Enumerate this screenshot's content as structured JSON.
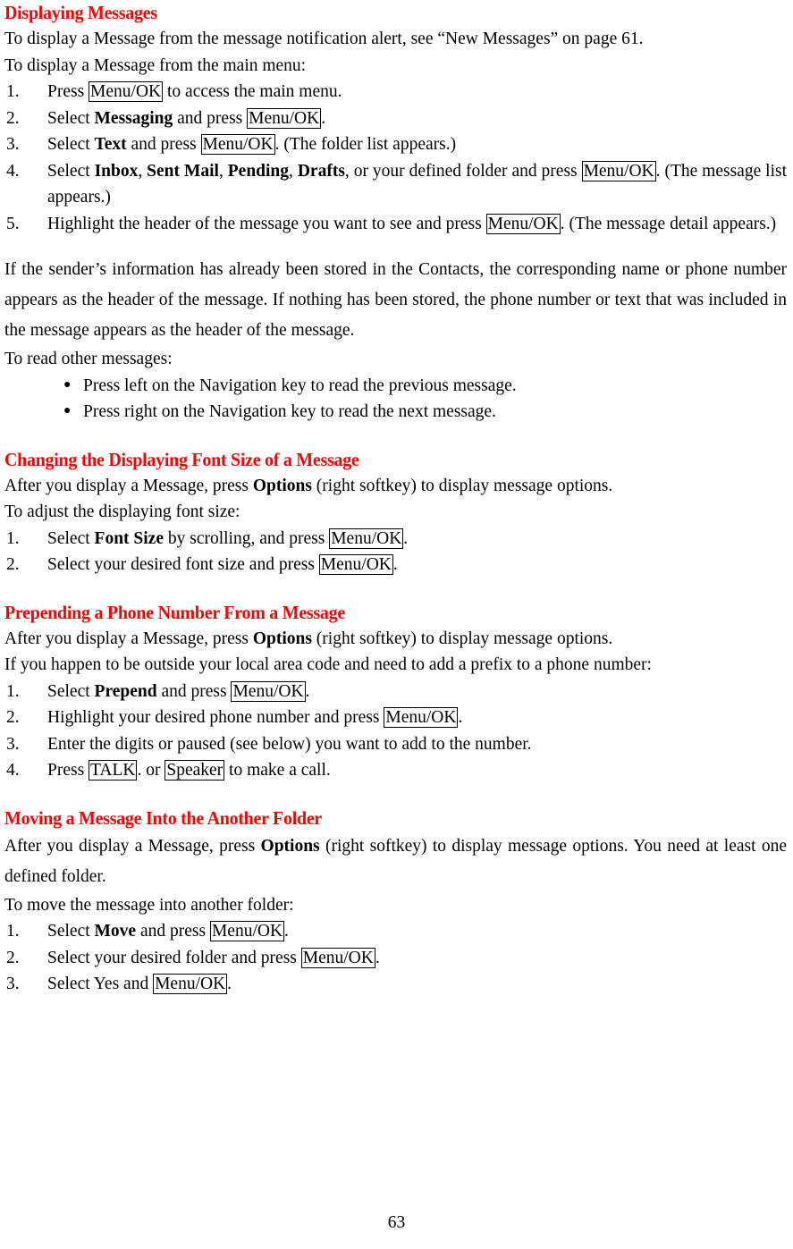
{
  "document": {
    "page_number": "63",
    "heading_color": "#ff0000",
    "body_color": "#000000"
  },
  "sections": [
    {
      "id": "displaying-messages",
      "heading": "Displaying Messages",
      "intro_1": "To display a Message from the message notification alert, see “New Messages” on page 61.",
      "intro_2": "To display a Message from the main menu:",
      "steps": [
        {
          "num": "1.",
          "parts": [
            {
              "type": "text",
              "value": "Press "
            },
            {
              "type": "key",
              "value": "Menu/OK"
            },
            {
              "type": "text",
              "value": " to access the main menu."
            }
          ]
        },
        {
          "num": "2.",
          "parts": [
            {
              "type": "text",
              "value": "Select "
            },
            {
              "type": "bold",
              "value": "Messaging"
            },
            {
              "type": "text",
              "value": " and press "
            },
            {
              "type": "key",
              "value": "Menu/OK"
            },
            {
              "type": "text",
              "value": "."
            }
          ]
        },
        {
          "num": "3.",
          "parts": [
            {
              "type": "text",
              "value": "Select "
            },
            {
              "type": "bold",
              "value": "Text"
            },
            {
              "type": "text",
              "value": " and press "
            },
            {
              "type": "key",
              "value": "Menu/OK"
            },
            {
              "type": "text",
              "value": ". (The folder list appears.)"
            }
          ]
        },
        {
          "num": "4.",
          "parts": [
            {
              "type": "text",
              "value": "Select "
            },
            {
              "type": "bold",
              "value": "Inbox"
            },
            {
              "type": "text",
              "value": ", "
            },
            {
              "type": "bold",
              "value": "Sent Mail"
            },
            {
              "type": "text",
              "value": ", "
            },
            {
              "type": "bold",
              "value": "Pending"
            },
            {
              "type": "text",
              "value": ", "
            },
            {
              "type": "bold",
              "value": "Drafts"
            },
            {
              "type": "text",
              "value": ", or your defined folder and press "
            },
            {
              "type": "key",
              "value": "Menu/OK"
            },
            {
              "type": "text",
              "value": ". (The message list appears.)"
            }
          ]
        },
        {
          "num": "5.",
          "parts": [
            {
              "type": "text",
              "value": "Highlight the header of the message you want to see and press "
            },
            {
              "type": "key",
              "value": "Menu/OK"
            },
            {
              "type": "text",
              "value": ". (The message detail appears.)"
            }
          ]
        }
      ],
      "paragraph": "If the sender’s information has already been stored in the Contacts, the corresponding name or phone number appears as the header of the message. If nothing has been stored, the phone number or text that was included in the message appears as the header of the message.",
      "lead_in": "To read other messages:",
      "bullets": [
        {
          "glyph": "●",
          "text": "Press left on the Navigation key to read the previous message."
        },
        {
          "glyph": "●",
          "text": "Press right on the Navigation key to read the next message."
        }
      ]
    },
    {
      "id": "changing-font-size",
      "heading": "Changing the Displaying Font Size of a Message",
      "intro_parts": [
        {
          "type": "text",
          "value": "After you display a Message, press "
        },
        {
          "type": "bold",
          "value": "Options"
        },
        {
          "type": "text",
          "value": " (right softkey) to display message options."
        }
      ],
      "lead_in": "To adjust the displaying font size:",
      "steps": [
        {
          "num": "1.",
          "parts": [
            {
              "type": "text",
              "value": "Select "
            },
            {
              "type": "bold",
              "value": "Font Size"
            },
            {
              "type": "text",
              "value": " by scrolling, and press "
            },
            {
              "type": "key",
              "value": "Menu/OK"
            },
            {
              "type": "text",
              "value": "."
            }
          ]
        },
        {
          "num": "2.",
          "parts": [
            {
              "type": "text",
              "value": "Select your desired font size and press "
            },
            {
              "type": "key",
              "value": "Menu/OK"
            },
            {
              "type": "text",
              "value": "."
            }
          ]
        }
      ]
    },
    {
      "id": "prepending-phone-number",
      "heading": "Prepending a Phone Number From a Message",
      "intro_parts": [
        {
          "type": "text",
          "value": "After you display a Message, press "
        },
        {
          "type": "bold",
          "value": "Options"
        },
        {
          "type": "text",
          "value": " (right softkey) to display message options."
        }
      ],
      "lead_in": "If you happen to be outside your local area code and need to add a prefix to a phone number:",
      "steps": [
        {
          "num": "1.",
          "parts": [
            {
              "type": "text",
              "value": "Select "
            },
            {
              "type": "bold",
              "value": "Prepend"
            },
            {
              "type": "text",
              "value": " and press "
            },
            {
              "type": "key",
              "value": "Menu/OK"
            },
            {
              "type": "text",
              "value": "."
            }
          ]
        },
        {
          "num": "2.",
          "parts": [
            {
              "type": "text",
              "value": "Highlight your desired phone number and press "
            },
            {
              "type": "key",
              "value": "Menu/OK"
            },
            {
              "type": "text",
              "value": "."
            }
          ]
        },
        {
          "num": "3.",
          "parts": [
            {
              "type": "text",
              "value": "Enter the digits or paused (see below) you want to add to the number."
            }
          ]
        },
        {
          "num": "4.",
          "parts": [
            {
              "type": "text",
              "value": "Press "
            },
            {
              "type": "key",
              "value": "TALK"
            },
            {
              "type": "text",
              "value": ". or "
            },
            {
              "type": "key",
              "value": "Speaker"
            },
            {
              "type": "text",
              "value": " to make a call."
            }
          ]
        }
      ]
    },
    {
      "id": "moving-message",
      "heading": "Moving a Message Into the Another Folder",
      "intro_parts": [
        {
          "type": "text",
          "value": "After you display a Message, press "
        },
        {
          "type": "bold",
          "value": "Options"
        },
        {
          "type": "text",
          "value": " (right softkey) to display message options. You need at least one defined folder."
        }
      ],
      "lead_in": "To move the message into another folder:",
      "steps": [
        {
          "num": "1.",
          "parts": [
            {
              "type": "text",
              "value": "Select "
            },
            {
              "type": "bold",
              "value": "Move"
            },
            {
              "type": "text",
              "value": " and press "
            },
            {
              "type": "key",
              "value": "Menu/OK"
            },
            {
              "type": "text",
              "value": "."
            }
          ]
        },
        {
          "num": "2.",
          "parts": [
            {
              "type": "text",
              "value": "Select your desired folder and press "
            },
            {
              "type": "key",
              "value": "Menu/OK"
            },
            {
              "type": "text",
              "value": "."
            }
          ]
        },
        {
          "num": "3.",
          "parts": [
            {
              "type": "text",
              "value": "Select Yes and "
            },
            {
              "type": "key",
              "value": "Menu/OK"
            },
            {
              "type": "text",
              "value": "."
            }
          ]
        }
      ]
    }
  ]
}
